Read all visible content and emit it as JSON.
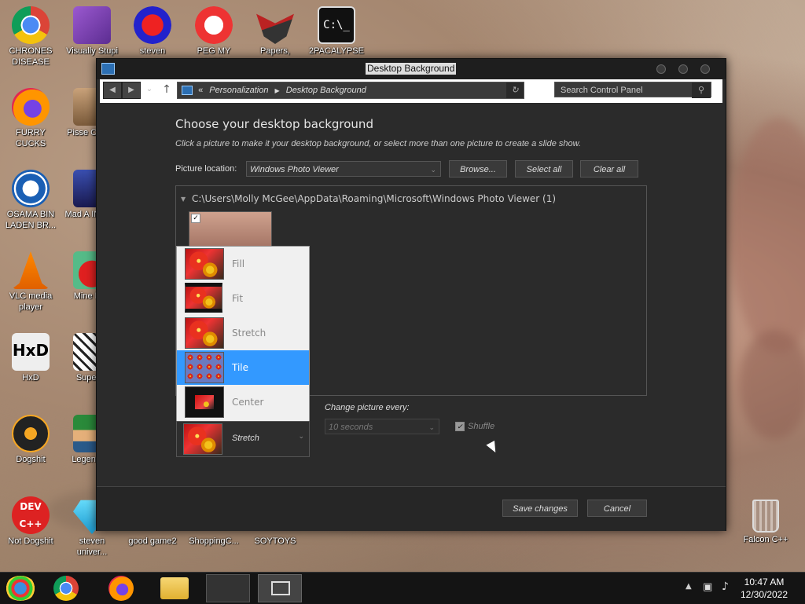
{
  "desktop": {
    "icons": [
      {
        "label": "CHRONES DISEASE"
      },
      {
        "label": "Visually Stupi"
      },
      {
        "label": "steven"
      },
      {
        "label": "PEG MY WIFE!"
      },
      {
        "label": "Papers,"
      },
      {
        "label": "2PACALYPSE"
      },
      {
        "label": "FURRY CUCKS"
      },
      {
        "label": "Pisse Chicke"
      },
      {
        "label": "OSAMA BIN LADEN BR..."
      },
      {
        "label": "Mad A IN SPA"
      },
      {
        "label": "VLC media player"
      },
      {
        "label": "Mine Bird"
      },
      {
        "label": "HxD"
      },
      {
        "label": "Super H"
      },
      {
        "label": "Dogshit"
      },
      {
        "label": "Legen Zild"
      },
      {
        "label": "Not Dogshit"
      },
      {
        "label": "steven univer..."
      },
      {
        "label": "good game2"
      },
      {
        "label": "ShoppingC..."
      },
      {
        "label": "SOYTOYS"
      },
      {
        "label": "Falcon C++"
      }
    ]
  },
  "window": {
    "title": "Desktop Background",
    "breadcrumb": {
      "prefix": "«",
      "items": [
        "Personalization",
        "Desktop Background"
      ]
    },
    "search_placeholder": "Search Control Panel",
    "heading": "Choose your desktop background",
    "subtext": "Click a picture to make it your desktop background, or select more than one picture to create a slide show.",
    "picture_location_label": "Picture location:",
    "picture_location_value": "Windows Photo Viewer",
    "browse_label": "Browse...",
    "select_all_label": "Select all",
    "clear_all_label": "Clear all",
    "folder_path": "C:\\Users\\Molly McGee\\AppData\\Roaming\\Microsoft\\Windows Photo Viewer (1)",
    "picture_position": {
      "options": [
        "Fill",
        "Fit",
        "Stretch",
        "Tile",
        "Center"
      ],
      "highlighted": "Tile",
      "selected_value": "Stretch"
    },
    "change_picture_label": "Change picture every:",
    "interval_value": "10 seconds",
    "shuffle_label": "Shuffle",
    "save_label": "Save changes",
    "cancel_label": "Cancel"
  },
  "taskbar": {
    "time": "10:47 AM",
    "date": "12/30/2022"
  }
}
